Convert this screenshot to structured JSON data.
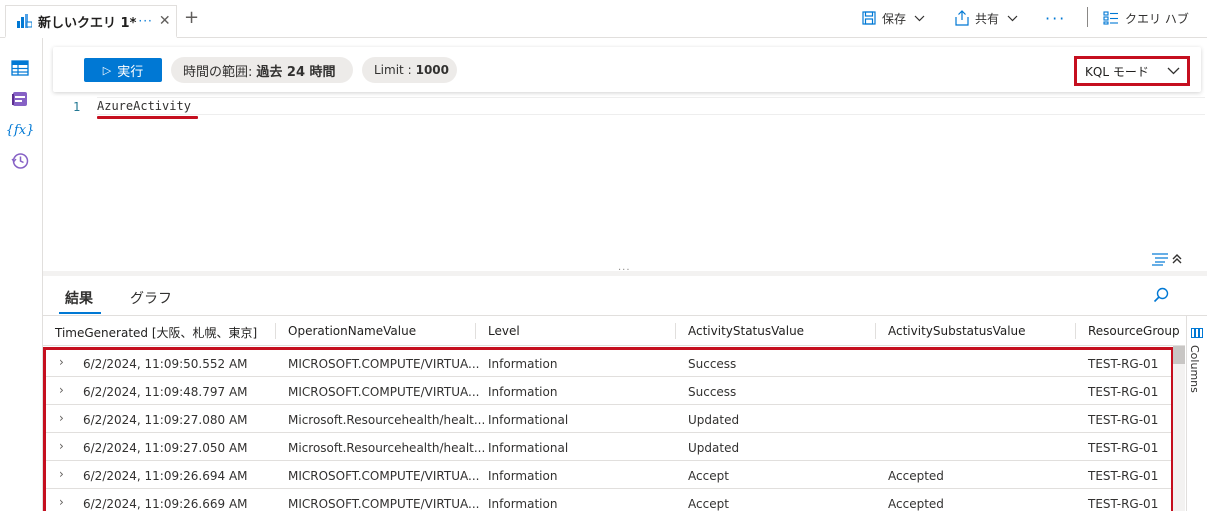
{
  "tab": {
    "title": "新しいクエリ 1*",
    "more": "···",
    "close": "✕",
    "add": "+"
  },
  "header": {
    "save_label": "保存",
    "share_label": "共有",
    "more": "···",
    "hub_label": "クエリ ハブ"
  },
  "toolbar": {
    "run_label": "実行",
    "time_range_label": "時間の範囲:",
    "time_range_value": "過去 24 時間",
    "limit_label": "Limit :",
    "limit_value": "1000",
    "mode_label": "KQL モード"
  },
  "editor": {
    "line_number": "1",
    "query": "AzureActivity"
  },
  "results": {
    "tabs": [
      "結果",
      "グラフ"
    ],
    "columns": [
      "TimeGenerated [大阪、札幌、東京]",
      "OperationNameValue",
      "Level",
      "ActivityStatusValue",
      "ActivitySubstatusValue",
      "ResourceGroup"
    ],
    "rows": [
      [
        "6/2/2024, 11:09:50.552 AM",
        "MICROSOFT.COMPUTE/VIRTUA...",
        "Information",
        "Success",
        "",
        "TEST-RG-01"
      ],
      [
        "6/2/2024, 11:09:48.797 AM",
        "MICROSOFT.COMPUTE/VIRTUA...",
        "Information",
        "Success",
        "",
        "TEST-RG-01"
      ],
      [
        "6/2/2024, 11:09:27.080 AM",
        "Microsoft.Resourcehealth/healt...",
        "Informational",
        "Updated",
        "",
        "TEST-RG-01"
      ],
      [
        "6/2/2024, 11:09:27.050 AM",
        "Microsoft.Resourcehealth/healt...",
        "Informational",
        "Updated",
        "",
        "TEST-RG-01"
      ],
      [
        "6/2/2024, 11:09:26.694 AM",
        "MICROSOFT.COMPUTE/VIRTUA...",
        "Information",
        "Accept",
        "Accepted",
        "TEST-RG-01"
      ],
      [
        "6/2/2024, 11:09:26.669 AM",
        "MICROSOFT.COMPUTE/VIRTUA...",
        "Information",
        "Accept",
        "Accepted",
        "TEST-RG-01"
      ]
    ],
    "columns_panel_label": "Columns"
  },
  "colors": {
    "accent": "#0078d4",
    "highlight": "#c50f1f"
  }
}
